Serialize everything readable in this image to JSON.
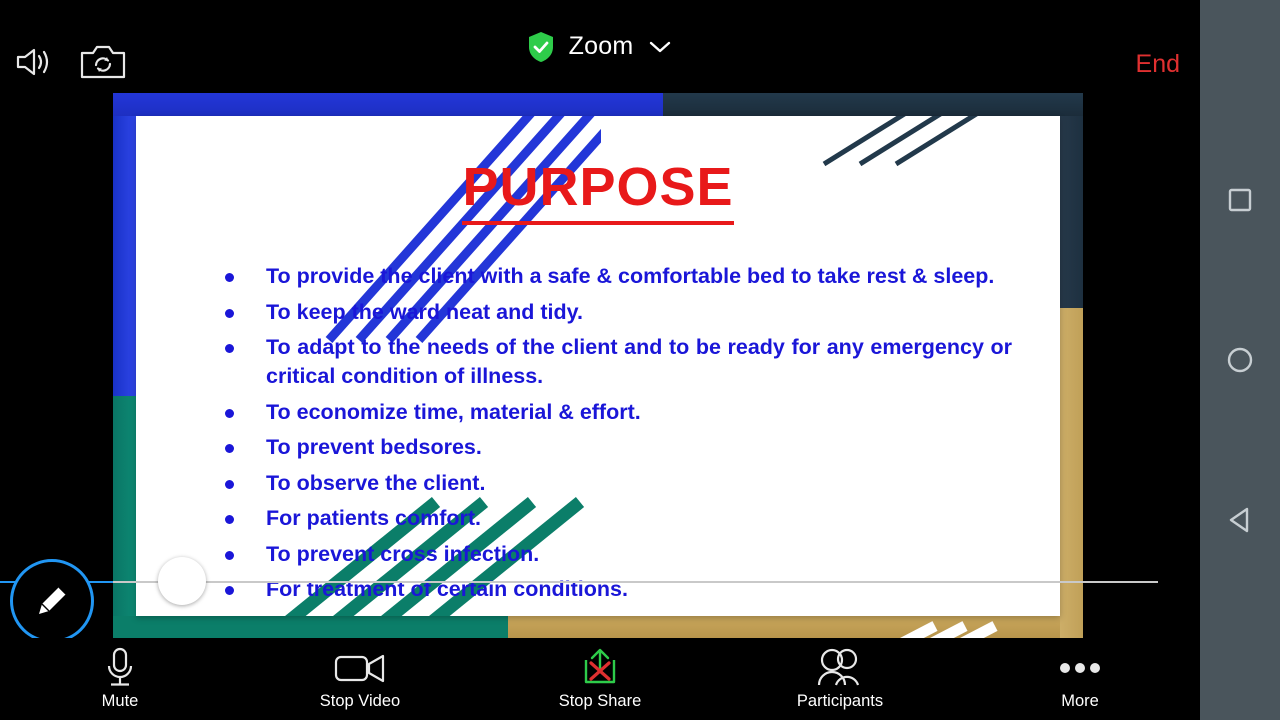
{
  "app": {
    "name": "Zoom",
    "platform": "android-tablet"
  },
  "topbar": {
    "speaker_icon": "speaker-volume-icon",
    "camera_switch_icon": "switch-camera-icon",
    "security_icon": "green-shield-check-icon",
    "title": "Zoom",
    "chevron_icon": "chevron-down-icon",
    "end_label": "End",
    "end_color": "#e03030"
  },
  "slide": {
    "title": "PURPOSE",
    "title_color": "#e8191a",
    "text_color": "#1a16d8",
    "bullets": [
      "To provide the client with a safe & comfortable bed to take rest & sleep.",
      "To keep the ward neat and tidy.",
      "To adapt to the needs of the client and to be ready for any emergency or critical condition of illness.",
      "To economize time, material & effort.",
      "To prevent bedsores.",
      "To observe the client.",
      "For patients comfort.",
      "To prevent cross infection.",
      "For treatment of certain conditions."
    ],
    "decor": {
      "blue": "#2336d8",
      "teal": "#0b7e69",
      "gold": "#c9a75c",
      "navy": "#22394b"
    }
  },
  "annotation": {
    "pencil_icon": "pencil-annotate-icon",
    "ring_color": "#2196f3",
    "line_color": "#c9c9c9",
    "handle": "slider-handle"
  },
  "toolbar": {
    "items": [
      {
        "label": "Mute",
        "icon": "microphone-icon"
      },
      {
        "label": "Stop Video",
        "icon": "video-camera-icon"
      },
      {
        "label": "Stop Share",
        "icon": "stop-share-icon"
      },
      {
        "label": "Participants",
        "icon": "participants-icon"
      },
      {
        "label": "More",
        "icon": "more-dots-icon"
      }
    ]
  },
  "navbar": {
    "background": "#4a555c",
    "items": [
      {
        "name": "recents",
        "icon": "square-icon"
      },
      {
        "name": "home",
        "icon": "circle-icon"
      },
      {
        "name": "back",
        "icon": "triangle-left-icon"
      }
    ]
  }
}
